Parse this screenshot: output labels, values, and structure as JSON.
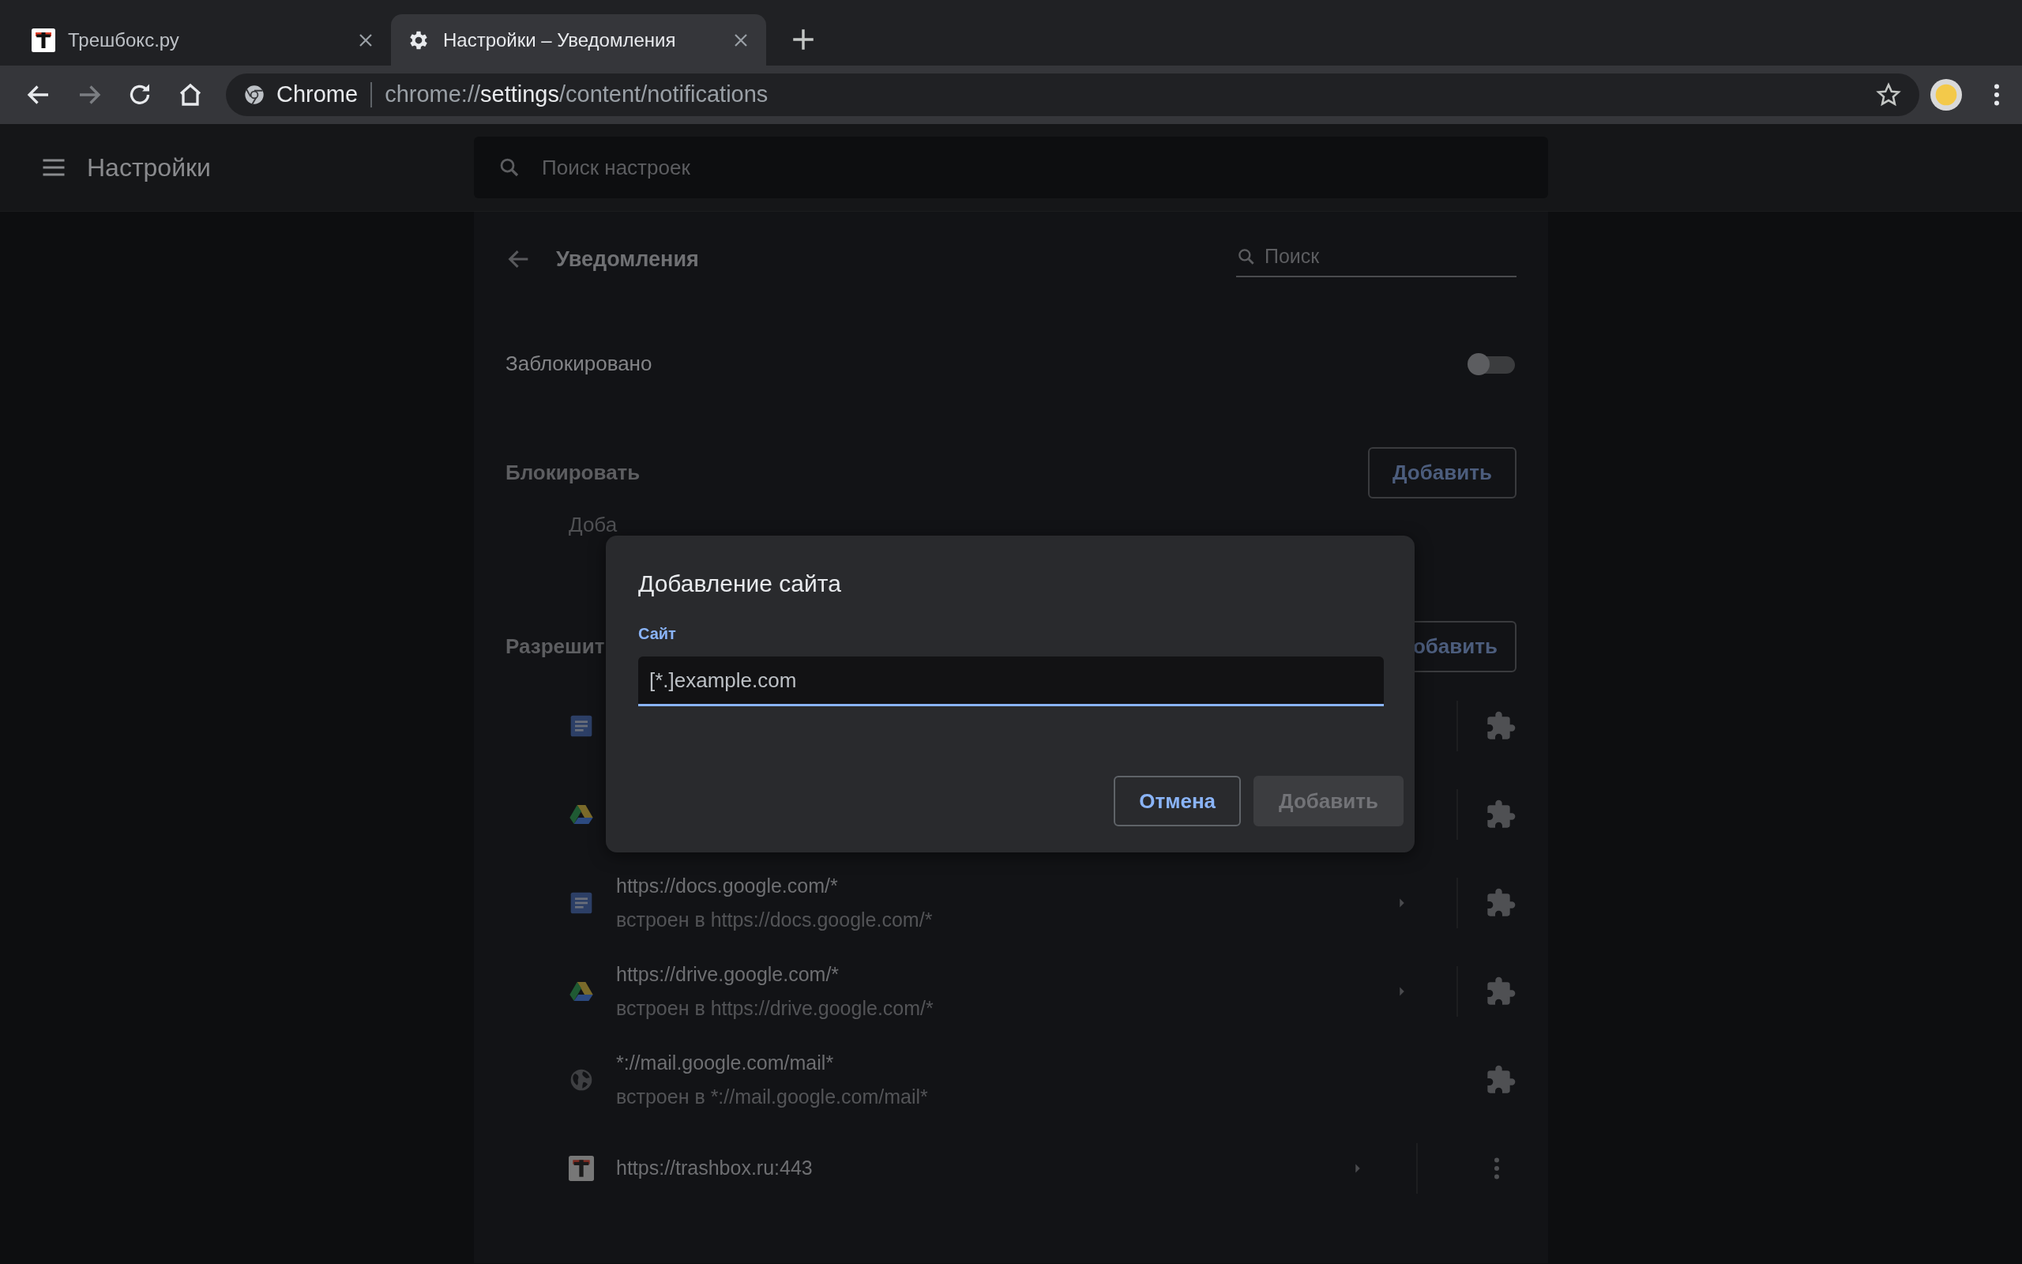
{
  "tabs": [
    {
      "title": "Трешбокс.ру",
      "kind": "trashbox",
      "selected": false
    },
    {
      "title": "Настройки – Уведомления",
      "kind": "gear",
      "selected": true
    }
  ],
  "omnibox": {
    "chip": "Chrome",
    "url_scheme": "chrome://",
    "url_host": "settings",
    "url_path": "/content/notifications"
  },
  "settings_header": {
    "title": "Настройки",
    "search": {
      "placeholder": "Поиск настроек"
    }
  },
  "page": {
    "title": "Уведомления",
    "search": {
      "placeholder": "Поиск"
    },
    "blocked_toggle": {
      "label": "Заблокировано",
      "on": false
    },
    "block_section": {
      "heading": "Блокировать",
      "button": "Добавить",
      "empty_text": "Доба"
    },
    "allow_section": {
      "heading": "Разрешит",
      "button": "обавить",
      "sites": [
        {
          "kind": "docs",
          "arrow": false,
          "divider": true,
          "action": {
            "kind": "puzzle"
          }
        },
        {
          "kind": "drive",
          "arrow": false,
          "divider": true,
          "action": {
            "kind": "puzzle"
          }
        },
        {
          "kind": "docs",
          "url": "https://docs.google.com/*",
          "embedded": "встроен в https://docs.google.com/*",
          "arrow": true,
          "divider": true,
          "action": {
            "kind": "puzzle"
          }
        },
        {
          "kind": "drive",
          "url": "https://drive.google.com/*",
          "embedded": "встроен в https://drive.google.com/*",
          "arrow": true,
          "divider": true,
          "action": {
            "kind": "puzzle"
          }
        },
        {
          "kind": "globe",
          "url": "*://mail.google.com/mail*",
          "embedded": "встроен в *://mail.google.com/mail*",
          "arrow": false,
          "divider": false,
          "action": {
            "kind": "puzzle"
          }
        },
        {
          "kind": "trashbox",
          "url": "https://trashbox.ru:443",
          "arrow": true,
          "divider": true,
          "action": {
            "kind": "menu"
          }
        }
      ]
    }
  },
  "dialog": {
    "title": "Добавление сайта",
    "field_label": "Сайт",
    "field": {
      "placeholder": "[*.]example.com"
    },
    "buttons": [
      {
        "label": "Отмена",
        "kind": "secondary",
        "disabled": false
      },
      {
        "label": "Добавить",
        "kind": "primary",
        "disabled": true
      }
    ]
  }
}
